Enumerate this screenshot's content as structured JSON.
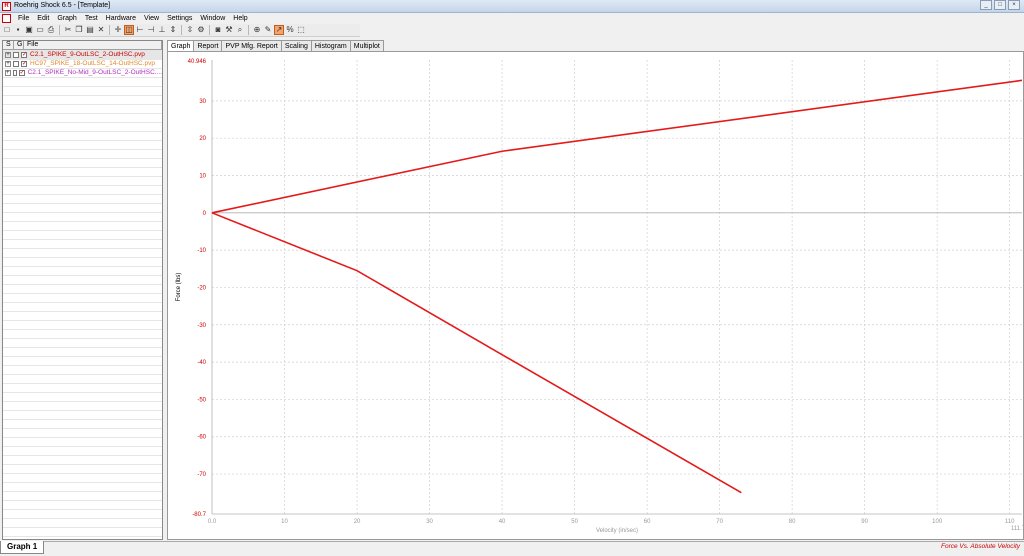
{
  "window": {
    "title": "Roehrig Shock 6.5 - [Template]",
    "icon": "app-icon",
    "controls": [
      "_",
      "□",
      "×"
    ]
  },
  "menu": [
    "File",
    "Edit",
    "Graph",
    "Test",
    "Hardware",
    "View",
    "Settings",
    "Window",
    "Help"
  ],
  "toolbar": [
    {
      "name": "new-icon",
      "glyph": "□"
    },
    {
      "name": "save-icon",
      "glyph": "▪"
    },
    {
      "name": "save-all-icon",
      "glyph": "▣"
    },
    {
      "name": "open-icon",
      "glyph": "▭"
    },
    {
      "name": "print-icon",
      "glyph": "⎙"
    },
    {
      "name": "cut-icon",
      "glyph": "✂"
    },
    {
      "name": "copy-icon",
      "glyph": "❐"
    },
    {
      "name": "paste-icon",
      "glyph": "▤"
    },
    {
      "name": "delete-icon",
      "glyph": "✕"
    },
    {
      "name": "crosshair-icon",
      "glyph": "✛"
    },
    {
      "name": "zoom-region-icon",
      "glyph": "◫"
    },
    {
      "name": "cursor-left-icon",
      "glyph": "⊢"
    },
    {
      "name": "cursor-right-icon",
      "glyph": "⊣"
    },
    {
      "name": "cursor-split-icon",
      "glyph": "⊥"
    },
    {
      "name": "marker-icon",
      "glyph": "⇕"
    },
    {
      "name": "measure-icon",
      "glyph": "⇳"
    },
    {
      "name": "settings-icon",
      "glyph": "⚙"
    },
    {
      "name": "camera-icon",
      "glyph": "◙"
    },
    {
      "name": "tool-icon",
      "glyph": "⚒"
    },
    {
      "name": "search-icon",
      "glyph": "⌕"
    },
    {
      "name": "zoom-icon",
      "glyph": "⊕"
    },
    {
      "name": "edit-icon",
      "glyph": "✎"
    },
    {
      "name": "axis-icon",
      "glyph": "↗"
    },
    {
      "name": "percent-icon",
      "glyph": "%"
    },
    {
      "name": "export-icon",
      "glyph": "⬚"
    }
  ],
  "files": {
    "headers": [
      "S",
      "G",
      "File"
    ],
    "rows": [
      {
        "name": "C2.1_SPIKE_9-OutLSC_2-OutHSC.pvp",
        "color": "#cc0000",
        "checked": true
      },
      {
        "name": "HC97_SPIKE_18-OutLSC_14-OutHSC.pvp",
        "color": "#e08a2a",
        "checked": true
      },
      {
        "name": "C2.1_SPIKE_No-Mid_9-OutLSC_2-OutHSC....",
        "color": "#b030c0",
        "checked": true
      }
    ]
  },
  "doc_tab": "Graph 1",
  "tabs": [
    "Graph",
    "Report",
    "PVP Mfg. Report",
    "Scaling",
    "Histogram",
    "Multiplot"
  ],
  "active_tab": "Graph",
  "footer": "Force Vs. Absolute Velocity",
  "chart_data": {
    "type": "line",
    "title": "",
    "xlabel": "Velocity (in/sec)",
    "ylabel": "Force (lbs)",
    "xlim": [
      0.0,
      111.7
    ],
    "ylim": [
      -80.7,
      40.946
    ],
    "x_ticks": [
      10,
      20,
      30,
      40,
      50,
      60,
      70,
      80,
      90,
      100,
      110
    ],
    "x_tick_labels": [
      "10",
      "20",
      "30",
      "40",
      "50",
      "60",
      "70",
      "80",
      "90",
      "100",
      "110"
    ],
    "x_min_label": "0.0",
    "x_max_label": "111.7",
    "y_ticks": [
      30,
      20,
      10,
      0,
      -10,
      -20,
      -30,
      -40,
      -50,
      -60,
      -70
    ],
    "y_tick_labels": [
      "30",
      "20",
      "10",
      "0",
      "-10",
      "-20",
      "-30",
      "-40",
      "-50",
      "-60",
      "-70"
    ],
    "y_max_label": "40.946",
    "y_min_label": "-80.7",
    "grid": true,
    "color": "#e41a1a",
    "series": [
      {
        "x": [
          0,
          40,
          111.7
        ],
        "y": [
          0,
          16.5,
          35.5
        ]
      },
      {
        "x": [
          0,
          20,
          40,
          73
        ],
        "y": [
          0,
          -15.5,
          -38,
          -75
        ]
      }
    ]
  }
}
